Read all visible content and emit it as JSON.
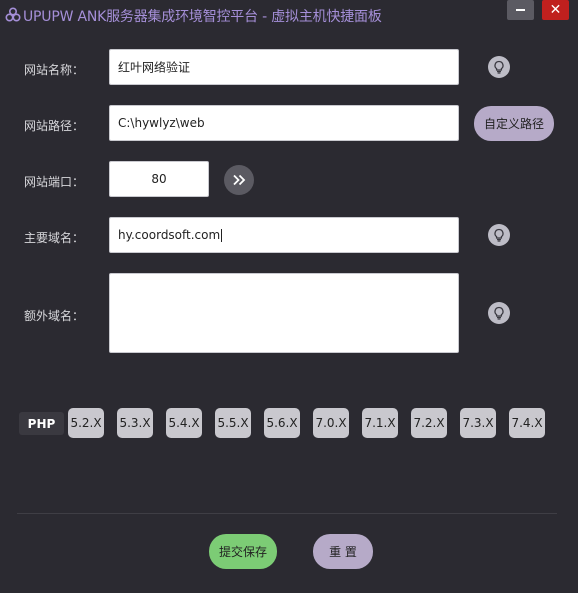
{
  "window": {
    "title": "UPUPW ANK服务器集成环境智控平台 - 虚拟主机快捷面板",
    "minimize_icon": "minimize-icon",
    "close_glyph": "✕"
  },
  "form": {
    "site_name": {
      "label": "网站名称：",
      "value": "红叶网络验证"
    },
    "site_path": {
      "label": "网站路径：",
      "value": "C:\\hywlyz\\web",
      "custom_button": "自定义路径"
    },
    "site_port": {
      "label": "网站端口：",
      "value": "80"
    },
    "main_domain": {
      "label": "主要域名：",
      "value": "hy.coordsoft.com"
    },
    "extra_domain": {
      "label": "额外域名：",
      "value": ""
    }
  },
  "php": {
    "label": "PHP",
    "versions": [
      "5.2.X",
      "5.3.X",
      "5.4.X",
      "5.5.X",
      "5.6.X",
      "7.0.X",
      "7.1.X",
      "7.2.X",
      "7.3.X",
      "7.4.X"
    ]
  },
  "actions": {
    "submit": "提交保存",
    "reset": "重 置"
  },
  "colors": {
    "background": "#2b2a31",
    "title": "#a58fd8",
    "submit": "#7ccc75",
    "secondary": "#b6aac8",
    "close": "#c0201e"
  }
}
